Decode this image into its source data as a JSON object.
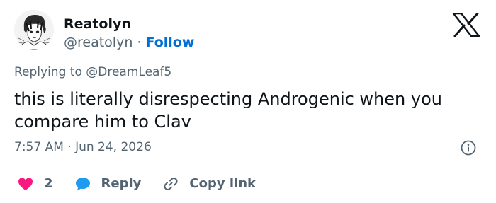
{
  "tweet": {
    "display_name": "Reatolyn",
    "handle": "@reatolyn",
    "separator": "·",
    "follow_label": "Follow",
    "replying_prefix": "Replying to",
    "replying_to": "@DreamLeaf5",
    "text": "this is literally disrespecting Androgenic when you compare him to Clav",
    "timestamp": "7:57 AM · Jun 24, 2026"
  },
  "actions": {
    "like_count": "2",
    "reply_label": "Reply",
    "copy_link_label": "Copy link"
  },
  "colors": {
    "like": "#f91880",
    "reply": "#1d9bf0",
    "follow": "#006fd6",
    "muted": "#536471"
  },
  "icons": [
    "x-logo-icon",
    "info-icon",
    "heart-icon",
    "speech-bubble-icon",
    "link-icon"
  ]
}
